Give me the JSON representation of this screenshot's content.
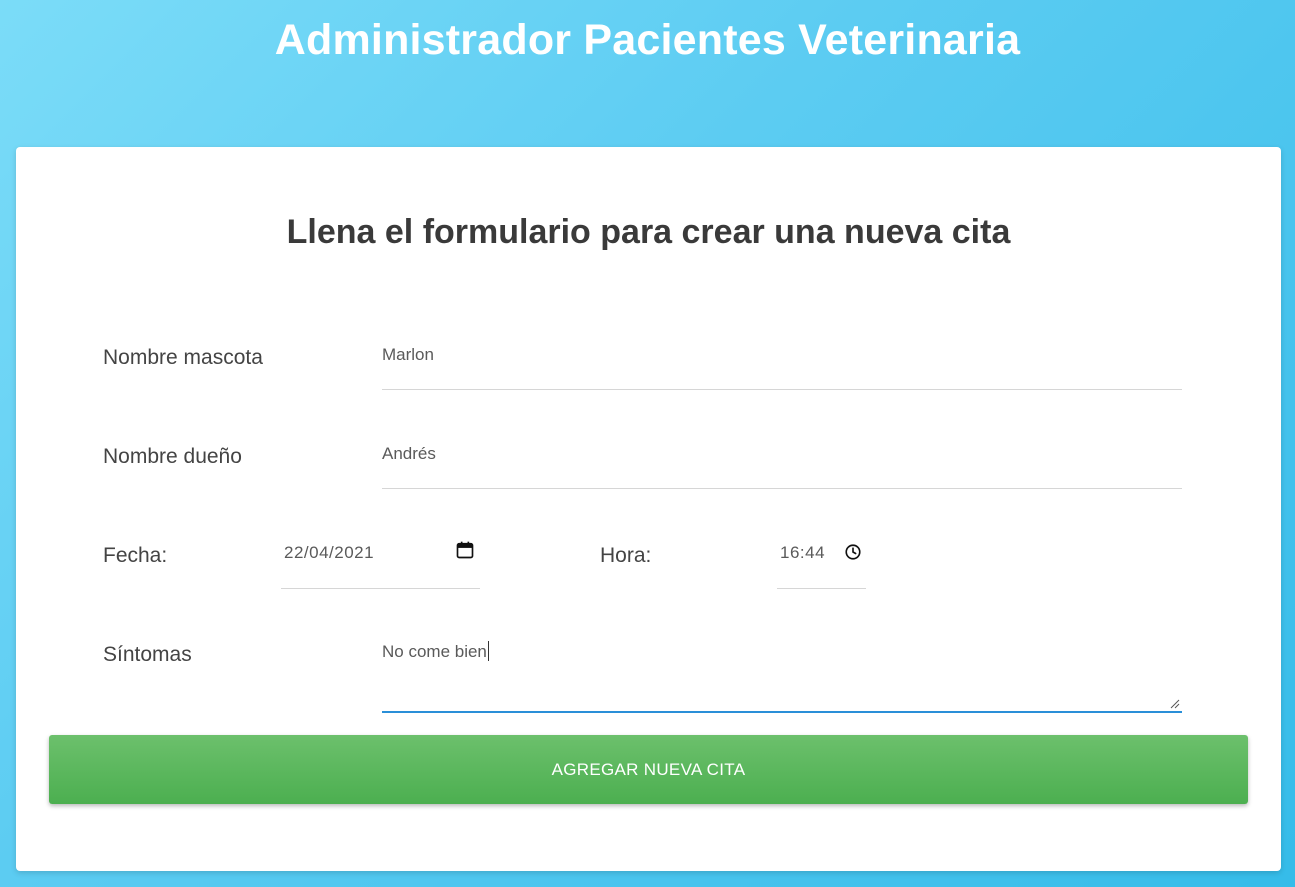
{
  "header": {
    "title": "Administrador Pacientes Veterinaria"
  },
  "form": {
    "title": "Llena el formulario para crear una nueva cita",
    "pet_name": {
      "label": "Nombre mascota",
      "value": "Marlon"
    },
    "owner_name": {
      "label": "Nombre dueño",
      "value": "Andrés"
    },
    "date": {
      "label": "Fecha:",
      "value": "22/04/2021",
      "icon": "calendar-icon"
    },
    "time": {
      "label": "Hora:",
      "value": "16:44",
      "icon": "clock-icon"
    },
    "symptoms": {
      "label": "Síntomas",
      "value": "No come bien"
    },
    "submit_label": "AGREGAR NUEVA CITA"
  },
  "colors": {
    "background_gradient_start": "#7bdcf8",
    "background_gradient_end": "#35bce9",
    "button": "#4caf50",
    "focus_underline": "#2a8fd8"
  }
}
